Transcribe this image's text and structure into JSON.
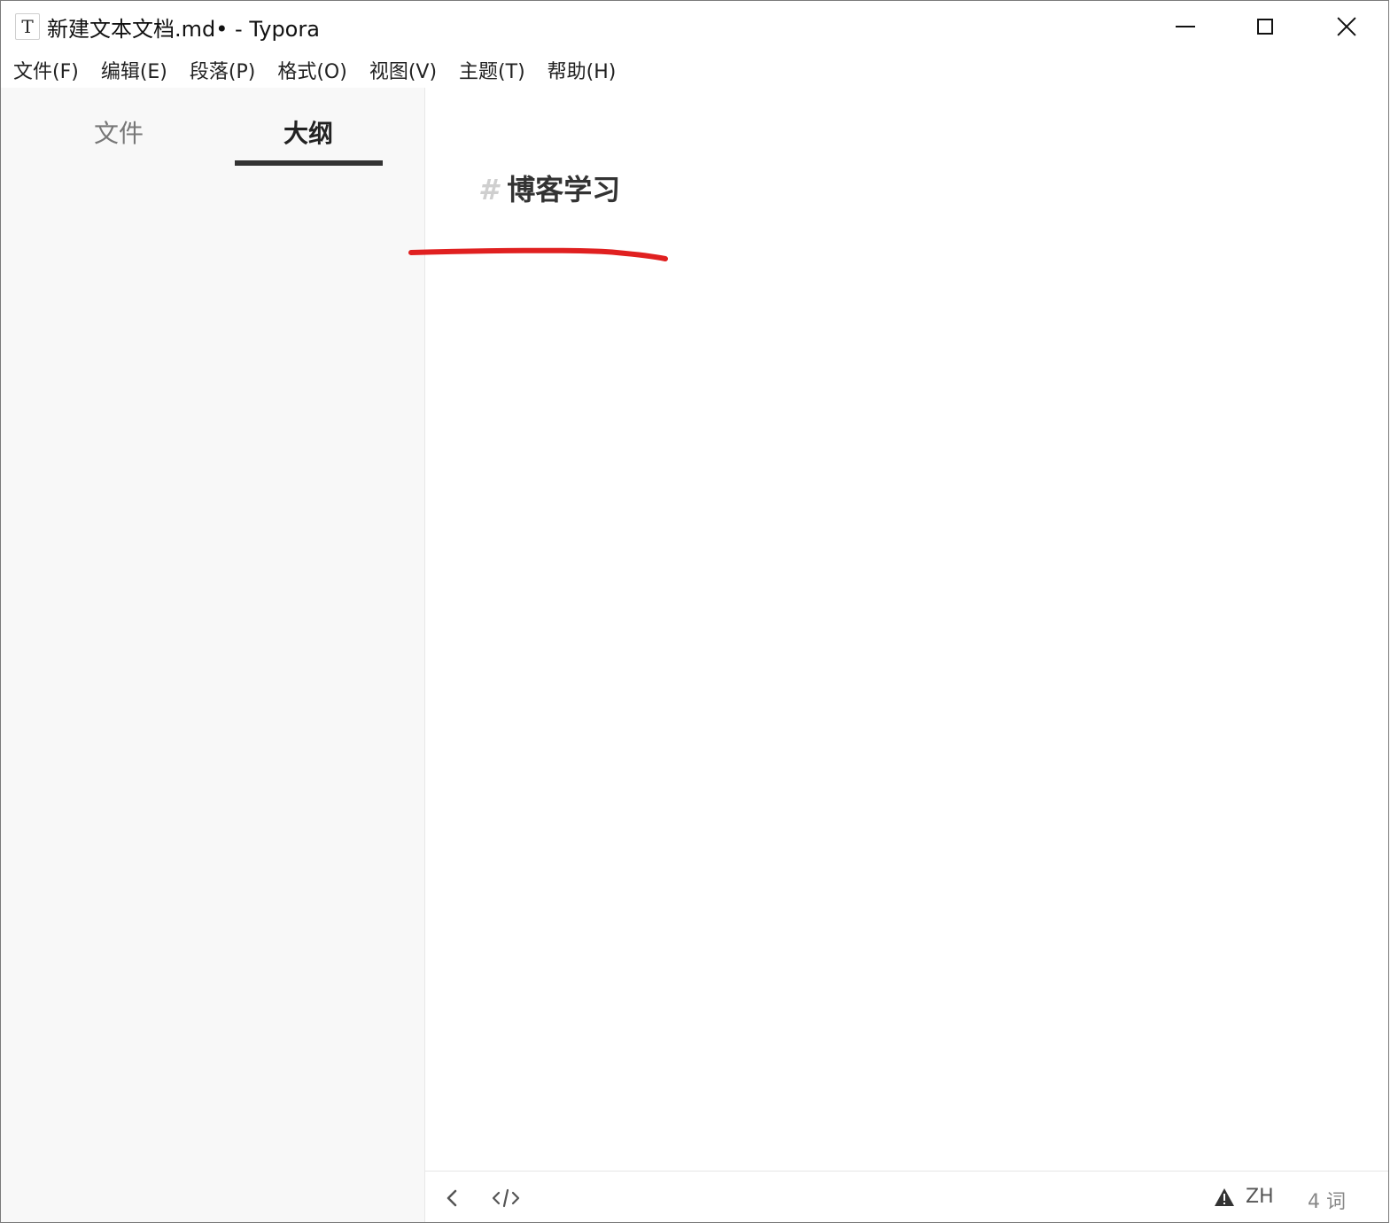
{
  "window": {
    "app_icon_letter": "T",
    "title": "新建文本文档.md• - Typora"
  },
  "menu": [
    {
      "label": "文件(F)"
    },
    {
      "label": "编辑(E)"
    },
    {
      "label": "段落(P)"
    },
    {
      "label": "格式(O)"
    },
    {
      "label": "视图(V)"
    },
    {
      "label": "主题(T)"
    },
    {
      "label": "帮助(H)"
    }
  ],
  "sidebar": {
    "tabs": [
      {
        "label": "文件",
        "active": false
      },
      {
        "label": "大纲",
        "active": true
      }
    ]
  },
  "editor": {
    "heading_marker": "#",
    "heading_text": "博客学习",
    "annotation_color": "#e02020"
  },
  "statusbar": {
    "language": "ZH",
    "word_count": "4 词"
  },
  "colors": {
    "sidebar_bg": "#f8f8f8",
    "active_tab_underline": "#333333"
  }
}
